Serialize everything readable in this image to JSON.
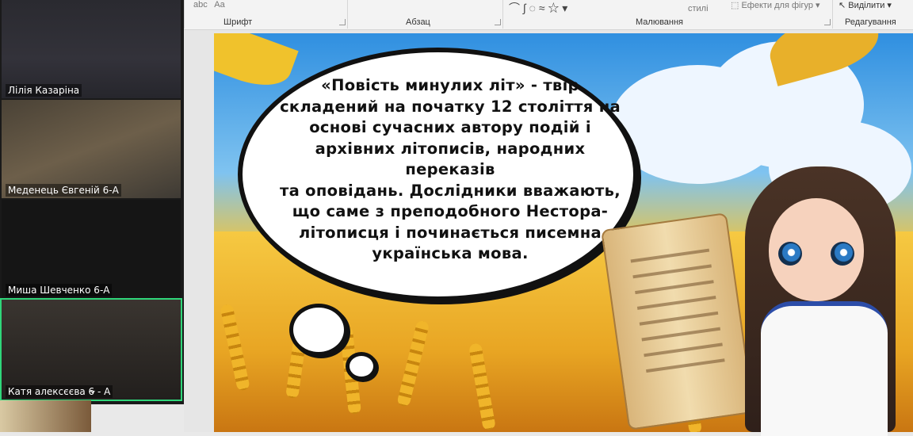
{
  "ribbon": {
    "groups": [
      "Шрифт",
      "Абзац",
      "Малювання",
      "Редагування"
    ],
    "styles_fragment": "стилі",
    "effects_label": "Ефекти для фігур",
    "select_label": "Виділити"
  },
  "participants": [
    {
      "name": "Лілія Казаріна"
    },
    {
      "name": "Меденець Євгеній 6-А"
    },
    {
      "name": "Миша Шевченко 6-А"
    },
    {
      "name": "Катя алексєєва 6 - А"
    }
  ],
  "slide": {
    "bubble_lines": [
      "«Повість минулих літ» -  твір",
      "складений на початку 12 століття на",
      "основі сучасних автору подій і",
      "архівних літописів, народних переказів",
      "та оповідань. Дослідники вважають,",
      "що саме з преподобного Нестора-",
      "літописця і починається писемна",
      "українська мова."
    ]
  },
  "colors": {
    "active_tile": "#2fd67a",
    "ribbon_bg": "#f3f3f3"
  }
}
